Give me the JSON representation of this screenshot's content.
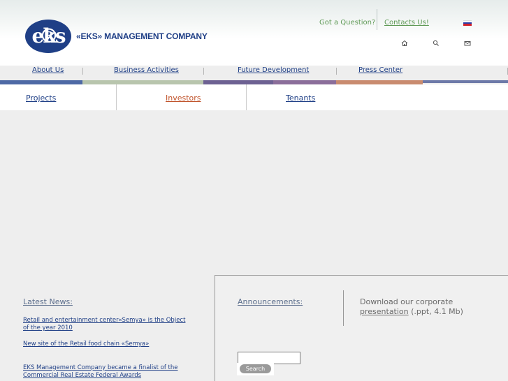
{
  "header": {
    "logo_text": "eks",
    "logo_reg": "®",
    "company_name": "«EKS» MANAGEMENT COMPANY",
    "question_text": "Got a Question?",
    "contacts_link": "Contacts Us!",
    "icons": [
      "home-icon",
      "search-icon",
      "mail-icon",
      "russian-flag-icon"
    ]
  },
  "nav": {
    "items": [
      {
        "label": "About Us"
      },
      {
        "label": "Business Activities"
      },
      {
        "label": "Future Development"
      },
      {
        "label": "Press Center"
      }
    ],
    "bar_colors": [
      "#4e69a5",
      "#b8c5ad",
      "#6d6192",
      "#8b6e9a",
      "#c98b6f",
      "#6d79a8"
    ]
  },
  "subnav": {
    "items": [
      {
        "label": "Projects",
        "color": "#1f3f86"
      },
      {
        "label": "Investors",
        "color": "#c0532b"
      },
      {
        "label": "Tenants",
        "color": "#1f3f86"
      }
    ]
  },
  "news": {
    "heading": "Latest News:",
    "items": [
      {
        "text": "Retail and entertainment center«Semya» is the Object of the year 2010"
      },
      {
        "text": "New site of the Retail food chain «Semya»"
      },
      {
        "text": "EKS Management Company became a finalist of the Commercial Real Estate Federal Awards"
      }
    ]
  },
  "announcements": {
    "heading": "Announcements:",
    "download_prefix": "Download our corporate",
    "download_link": "presentation",
    "download_suffix": " (.ppt, 4.1 Mb)"
  },
  "search": {
    "value": "",
    "button_label": "Search"
  }
}
